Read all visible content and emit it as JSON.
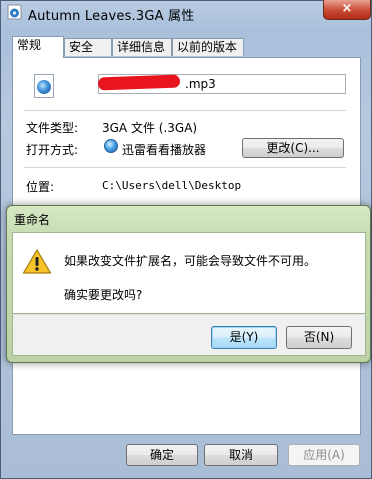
{
  "window": {
    "title": "Autumn Leaves.3GA 属性",
    "close_label": "×"
  },
  "tabs": [
    {
      "label": "常规"
    },
    {
      "label": "安全"
    },
    {
      "label": "详细信息"
    },
    {
      "label": "以前的版本"
    }
  ],
  "general": {
    "filename_suffix": ".mp3",
    "filetype_label": "文件类型:",
    "filetype_value": "3GA 文件 (.3GA)",
    "openwith_label": "打开方式:",
    "openwith_app": "迅雷看看播放器",
    "change_button": "更改(C)...",
    "location_label": "位置:",
    "location_value": "C:\\Users\\dell\\Desktop"
  },
  "dialog": {
    "title": "重命名",
    "message": "如果改变文件扩展名，可能会导致文件不可用。",
    "question": "确实要更改吗?",
    "yes_button": "是(Y)",
    "no_button": "否(N)"
  },
  "footer": {
    "ok_button": "确定",
    "cancel_button": "取消",
    "apply_button": "应用(A)"
  },
  "colors": {
    "dialog_frame": "#c7dcb3",
    "window_frame": "#a9c0db",
    "close_button": "#c84b33",
    "warning_icon": "#f7c52b"
  }
}
